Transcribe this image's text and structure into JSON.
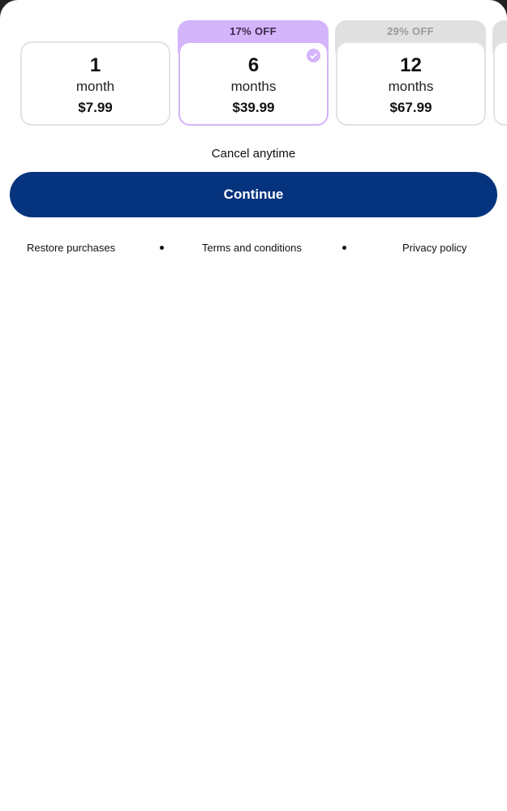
{
  "plans": [
    {
      "number": "1",
      "unit": "month",
      "price": "$7.99",
      "badge": null,
      "selected": false
    },
    {
      "number": "6",
      "unit": "months",
      "price": "$39.99",
      "badge": "17% OFF",
      "selected": true
    },
    {
      "number": "12",
      "unit": "months",
      "price": "$67.99",
      "badge": "29% OFF",
      "selected": false
    }
  ],
  "cancel_text": "Cancel anytime",
  "continue_label": "Continue",
  "footer": {
    "restore": "Restore purchases",
    "terms": "Terms and conditions",
    "privacy": "Privacy policy"
  },
  "colors": {
    "accent": "#05337d",
    "selected": "#d4b4fa",
    "badge_inactive": "#e0e0e0"
  }
}
